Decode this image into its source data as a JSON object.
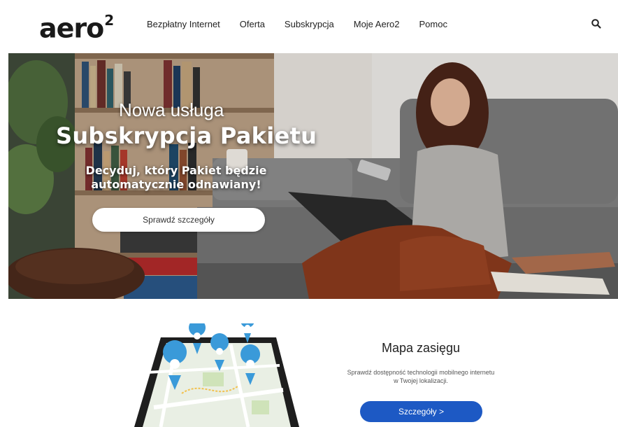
{
  "header": {
    "logo_text": "aero",
    "logo_superscript": "2",
    "nav": [
      {
        "label": "Bezpłatny Internet"
      },
      {
        "label": "Oferta"
      },
      {
        "label": "Subskrypcja"
      },
      {
        "label": "Moje Aero2"
      },
      {
        "label": "Pomoc"
      }
    ],
    "search_icon": "search-icon"
  },
  "hero": {
    "pretitle": "Nowa usługa",
    "title": "Subskrypcja Pakietu",
    "subtitle": "Decyduj, który Pakiet będzie automatycznie odnawiany!",
    "button_label": "Sprawdź szczegóły"
  },
  "coverage": {
    "title": "Mapa zasięgu",
    "description": "Sprawdź dostępność technologii mobilnego internetu w Twojej lokalizacji.",
    "button_label": "Szczegóły >"
  },
  "colors": {
    "accent": "#1d59c4",
    "pin": "#3a9ad9"
  }
}
